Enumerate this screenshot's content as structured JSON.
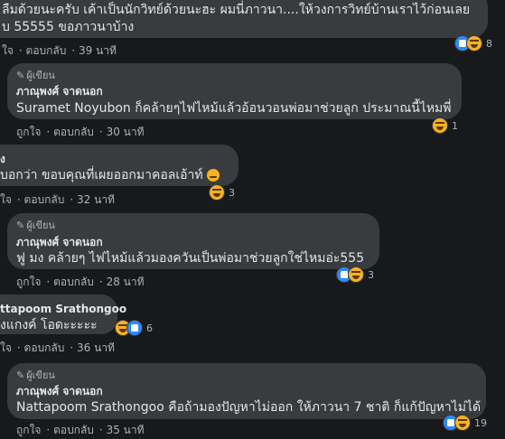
{
  "comments": [
    {
      "text_line1": "ลืมด้วยนะครับ เค้าเป็นนักวิทย์ด้วยนะฮะ ผมนี่ภาวนา....ให้วงการวิทย์บ้านเราไว้ก่อนเลย",
      "text_line2": "บ 55555 ขอภาวนาบ้าง",
      "actions": {
        "like": "ใจ",
        "reply": "ตอบกลับ",
        "time": "39 นาที"
      },
      "reaction_count": "8"
    },
    {
      "badge": "ผู้เขียน",
      "author": "ภาณุพงศ์ จาดนอก",
      "text": "Suramet Noyubon ก็คล้ายๆไฟไหม้แล้วอ้อนวอนพ่อมาช่วยลูก ประมาณนี้ไหมพี่",
      "actions": {
        "like": "ถูกใจ",
        "reply": "ตอบกลับ",
        "time": "30 นาที"
      },
      "reaction_count": "1"
    },
    {
      "author_partial": "ง",
      "text": "บอกว่า ขอบคุณที่เผยออกมาคอลเอ้าท์",
      "actions": {
        "like": "ใจ",
        "reply": "ตอบกลับ",
        "time": "32 นาที"
      },
      "reaction_count": "3"
    },
    {
      "badge": "ผู้เขียน",
      "author": "ภาณุพงศ์ จาดนอก",
      "text": "ฟู มง คล้ายๆ ไฟไหม้แล้วมองควันเป็นพ่อมาช่วยลูกใช่ไหมอ่ะ555",
      "actions": {
        "like": "ถูกใจ",
        "reply": "ตอบกลับ",
        "time": "28 นาที"
      },
      "reaction_count": "3"
    },
    {
      "author_partial": "ttapoom Srathongoo",
      "text": "งแกงค์ โอดะะะะะ",
      "actions": {
        "like": "ใจ",
        "reply": "ตอบกลับ",
        "time": "36 นาที"
      },
      "reaction_count": "6"
    },
    {
      "badge": "ผู้เขียน",
      "author": "ภาณุพงศ์ จาดนอก",
      "text": "Nattapoom Srathongoo คือถ้ามองปัญหาไม่ออก ให้ภาวนา 7 ชาติ ก็แก้ปัญหาไม่ได้",
      "actions": {
        "like": "ถูกใจ",
        "reply": "ตอบกลับ",
        "time": "35 นาที"
      },
      "reaction_count": "19"
    }
  ],
  "icons": {
    "badge_icon": "pencil-icon",
    "like": "like-reaction-icon",
    "haha": "haha-reaction-icon"
  },
  "colors": {
    "background": "#18191a",
    "bubble": "#3a3b3c",
    "text": "#e4e6eb",
    "muted": "#b0b3b8",
    "like_blue": "#2d88ff",
    "haha_yellow": "#f7b125"
  }
}
